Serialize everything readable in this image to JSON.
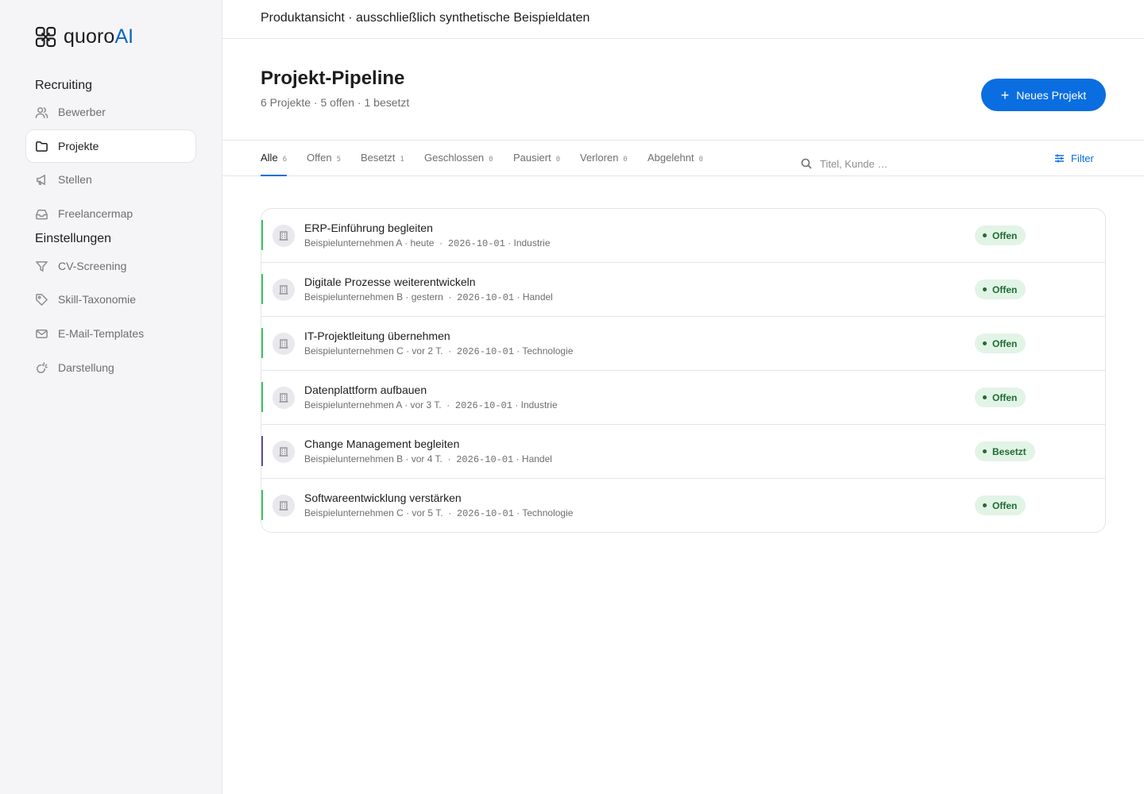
{
  "brand": {
    "name": "quoro",
    "accent": "AI"
  },
  "sidebar": {
    "sections": [
      {
        "label": "Recruiting"
      },
      {
        "label": "Einstellungen"
      }
    ],
    "items": [
      {
        "label": "Bewerber",
        "icon": "users-icon"
      },
      {
        "label": "Projekte",
        "icon": "folder-icon",
        "active": true
      },
      {
        "label": "Stellen",
        "icon": "megaphone-icon"
      },
      {
        "label": "Freelancermap",
        "icon": "inbox-icon"
      },
      {
        "label": "CV-Screening",
        "icon": "filter-icon"
      },
      {
        "label": "Skill-Taxonomie",
        "icon": "tag-icon"
      },
      {
        "label": "E-Mail-Templates",
        "icon": "mail-icon"
      },
      {
        "label": "Darstellung",
        "icon": "theme-icon"
      }
    ]
  },
  "topbar": {
    "text": "Produktansicht · ausschließlich synthetische Beispieldaten"
  },
  "header": {
    "title": "Projekt-Pipeline",
    "subtitle": "6 Projekte · 5 offen · 1 besetzt",
    "new_button": "Neues Projekt"
  },
  "tabs": [
    {
      "label": "Alle",
      "count": "6",
      "active": true
    },
    {
      "label": "Offen",
      "count": "5"
    },
    {
      "label": "Besetzt",
      "count": "1"
    },
    {
      "label": "Geschlossen",
      "count": "0"
    },
    {
      "label": "Pausiert",
      "count": "0"
    },
    {
      "label": "Verloren",
      "count": "0"
    },
    {
      "label": "Abgelehnt",
      "count": "0"
    }
  ],
  "search": {
    "placeholder": "Titel, Kunde …",
    "value": ""
  },
  "filter": {
    "label": "Filter"
  },
  "colors": {
    "accent": "#0a6ee0",
    "open": "#34c759",
    "filled": "#5e4aa8",
    "badge_bg": "#e2f4e6",
    "badge_text": "#1e6b34"
  },
  "projects": [
    {
      "title": "ERP-Einführung begleiten",
      "client": "Beispielunternehmen A",
      "age": "heute",
      "date": "2026-10-01",
      "industry": "Industrie",
      "status": "Offen",
      "status_color": "#34c759"
    },
    {
      "title": "Digitale Prozesse weiterentwickeln",
      "client": "Beispielunternehmen B",
      "age": "gestern",
      "date": "2026-10-01",
      "industry": "Handel",
      "status": "Offen",
      "status_color": "#34c759"
    },
    {
      "title": "IT-Projektleitung übernehmen",
      "client": "Beispielunternehmen C",
      "age": "vor 2 T.",
      "date": "2026-10-01",
      "industry": "Technologie",
      "status": "Offen",
      "status_color": "#34c759"
    },
    {
      "title": "Datenplattform aufbauen",
      "client": "Beispielunternehmen A",
      "age": "vor 3 T.",
      "date": "2026-10-01",
      "industry": "Industrie",
      "status": "Offen",
      "status_color": "#34c759"
    },
    {
      "title": "Change Management begleiten",
      "client": "Beispielunternehmen B",
      "age": "vor 4 T.",
      "date": "2026-10-01",
      "industry": "Handel",
      "status": "Besetzt",
      "status_color": "#5e4aa8"
    },
    {
      "title": "Softwareentwicklung verstärken",
      "client": "Beispielunternehmen C",
      "age": "vor 5 T.",
      "date": "2026-10-01",
      "industry": "Technologie",
      "status": "Offen",
      "status_color": "#34c759"
    }
  ]
}
